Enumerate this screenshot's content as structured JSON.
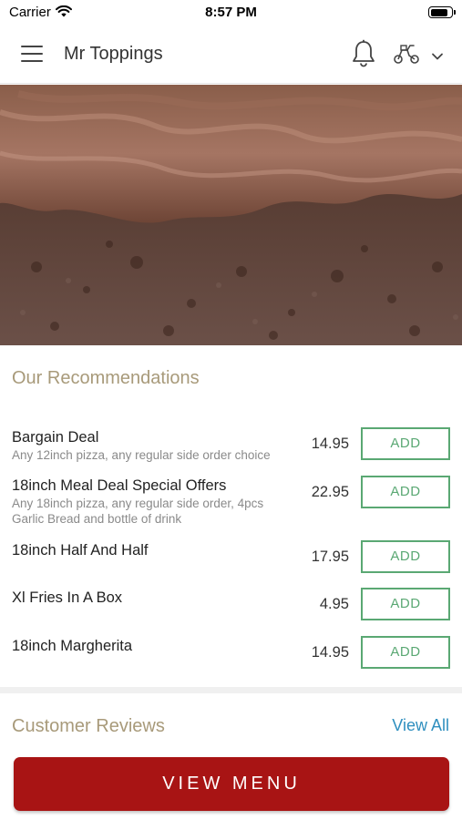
{
  "status_bar": {
    "carrier": "Carrier",
    "time": "8:57 PM",
    "battery_level": 0.9
  },
  "header": {
    "title": "Mr Toppings",
    "icons": [
      "menu-icon",
      "bell-icon",
      "scooter-icon",
      "chevron-down-icon"
    ]
  },
  "hero": {
    "image": "chocolate-cake"
  },
  "recommendations": {
    "title": "Our Recommendations",
    "add_label": "ADD",
    "items": [
      {
        "name": "Bargain Deal",
        "description": "Any 12inch pizza, any regular side order choice",
        "price": "14.95"
      },
      {
        "name": "18inch Meal Deal Special Offers",
        "description": "Any 18inch pizza, any regular side order, 4pcs Garlic Bread and bottle of drink",
        "price": "22.95"
      },
      {
        "name": "18inch Half And Half",
        "description": "",
        "price": "17.95"
      },
      {
        "name": "Xl Fries In A Box",
        "description": "",
        "price": "4.95"
      },
      {
        "name": "18inch Margherita",
        "description": "",
        "price": "14.95"
      }
    ]
  },
  "reviews": {
    "title": "Customer Reviews",
    "view_all_label": "View All"
  },
  "footer": {
    "view_menu_label": "VIEW MENU"
  },
  "colors": {
    "accent_green": "#5aa873",
    "menu_button_red": "#a81414",
    "section_title": "#a89a7a",
    "link_blue": "#2f8fbf"
  }
}
